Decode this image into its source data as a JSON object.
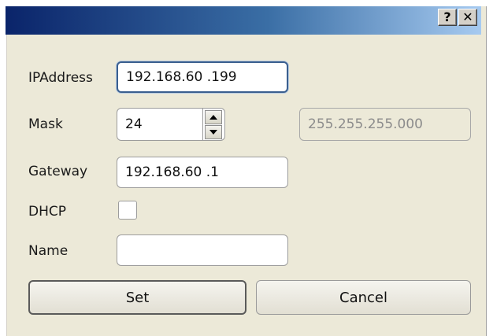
{
  "window": {
    "title": "",
    "help_label": "?",
    "close_label": "✕"
  },
  "form": {
    "ip_label": "IPAddress",
    "ip_value": "192.168.60 .199",
    "mask_label": "Mask",
    "mask_value": "24",
    "mask_display": "255.255.255.000",
    "gateway_label": "Gateway",
    "gateway_value": "192.168.60 .1",
    "dhcp_label": "DHCP",
    "dhcp_checked": false,
    "name_label": "Name",
    "name_value": ""
  },
  "buttons": {
    "set_label": "Set",
    "cancel_label": "Cancel"
  },
  "icons": {
    "spin_up": "triangle-up-icon",
    "spin_down": "triangle-down-icon"
  }
}
